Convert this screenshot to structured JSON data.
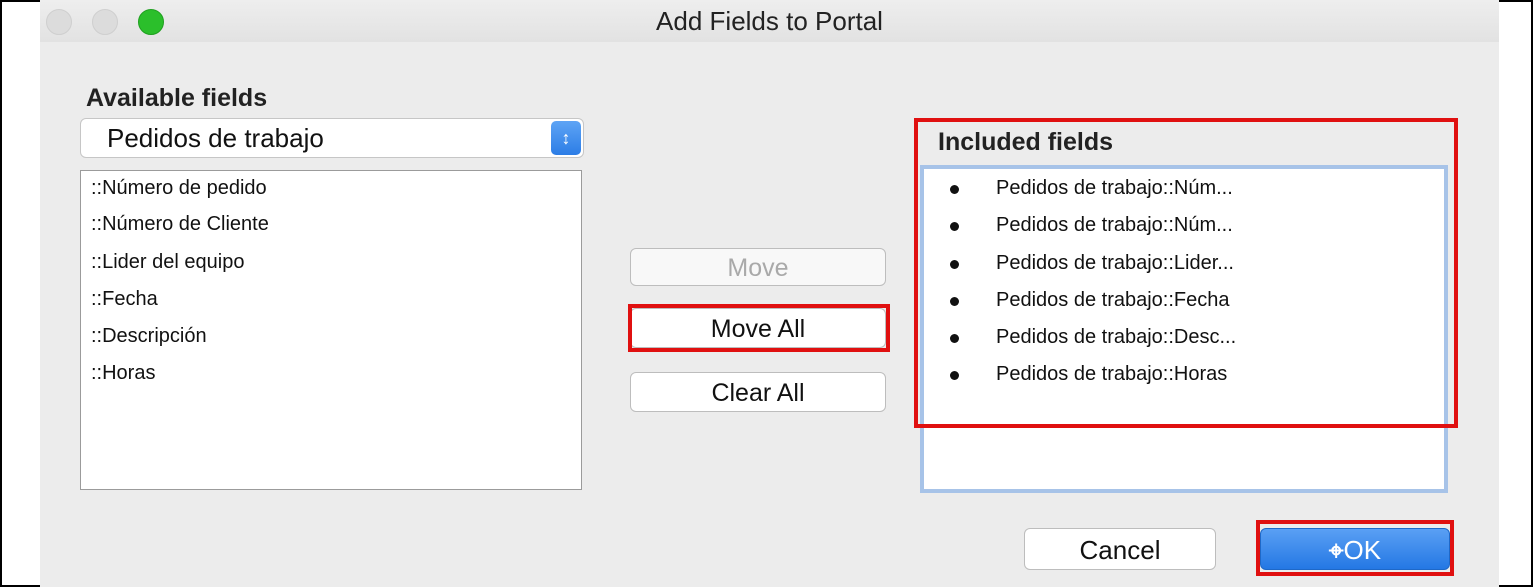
{
  "window": {
    "title": "Add Fields to Portal"
  },
  "available": {
    "label": "Available fields",
    "table_selected": "Pedidos de trabajo",
    "popup_icon": "updown-chevron-icon",
    "fields": [
      "::Número de pedido",
      "::Número de Cliente",
      "::Lider del equipo",
      "::Fecha",
      "::Descripción",
      "::Horas"
    ]
  },
  "buttons": {
    "move": "Move",
    "move_all": "Move All",
    "clear_all": "Clear All",
    "cancel": "Cancel",
    "ok": "OK"
  },
  "included": {
    "label": "Included fields",
    "fields": [
      "Pedidos de trabajo::Núm...",
      "Pedidos de trabajo::Núm...",
      "Pedidos de trabajo::Lider...",
      "Pedidos de trabajo::Fecha",
      "Pedidos de trabajo::Desc...",
      "Pedidos de trabajo::Horas"
    ]
  },
  "colors": {
    "highlight": "#e01010",
    "accent": "#2c7de6",
    "traffic_green": "#2bbf2b"
  }
}
